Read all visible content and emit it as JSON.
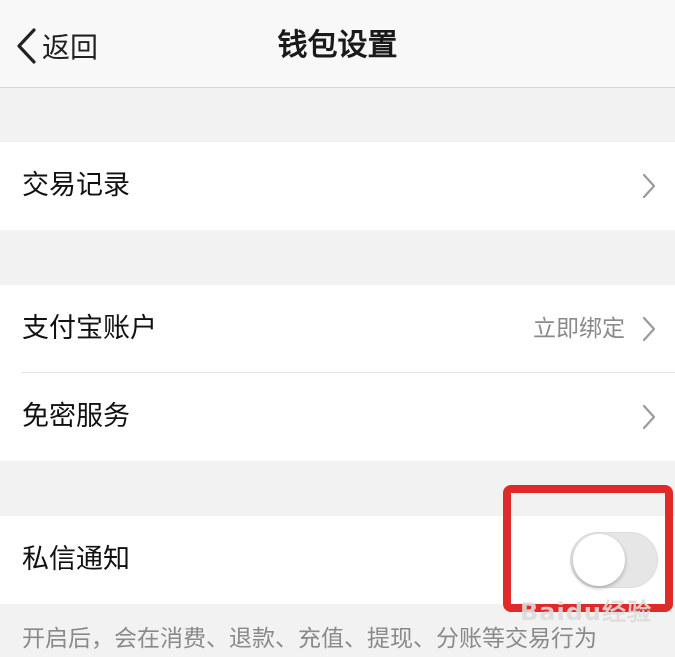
{
  "header": {
    "back_label": "返回",
    "title": "钱包设置"
  },
  "cells": {
    "transactions": {
      "label": "交易记录"
    },
    "alipay": {
      "label": "支付宝账户",
      "value": "立即绑定"
    },
    "password_free": {
      "label": "免密服务"
    },
    "private_message": {
      "label": "私信通知",
      "toggle_on": false
    }
  },
  "description": "开启后，会在消费、退款、充值、提现、分账等交易行为",
  "watermark": "Baidu经验",
  "colors": {
    "highlight": "#e02a2a",
    "switch_off": "#e6e6e6",
    "background": "#f2f2f2"
  },
  "icons": {
    "back": "chevron-left-icon",
    "row_arrow": "chevron-right-icon"
  }
}
